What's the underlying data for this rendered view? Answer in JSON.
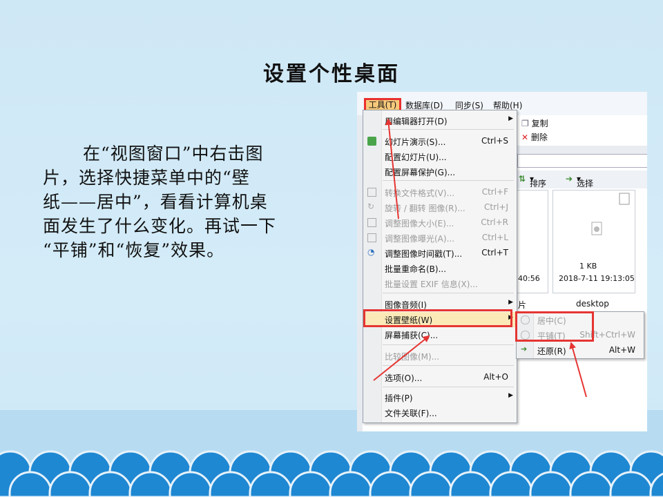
{
  "slide": {
    "title": "设置个性桌面",
    "paragraph_lines": [
      "在“视图窗口”中右击图",
      "片，选择快捷菜单中的“壁",
      "纸——居中”，看看计算机桌",
      "面发生了什么变化。再试一下",
      "“平铺”和“恢复”效果。"
    ]
  },
  "menubar": {
    "tools": "工具(T)",
    "items": [
      "数据库(D)",
      "同步(S)",
      "帮助(H)"
    ]
  },
  "toolbar": {
    "copy": "复制",
    "delete": "删除"
  },
  "viewbar": {
    "sort": "排序",
    "select": "选择"
  },
  "files": [
    {
      "name": "片",
      "date": "40:56"
    },
    {
      "name": "desktop",
      "size": "1 KB",
      "date": "2018-7-11 19:13:05"
    }
  ],
  "menu": [
    {
      "label": "用编辑器打开(D)",
      "shortcut": "",
      "submenu": true,
      "disabled": false
    },
    {
      "label": "幻灯片演示(S)...",
      "shortcut": "Ctrl+S",
      "disabled": false
    },
    {
      "label": "配置幻灯片(U)...",
      "shortcut": "",
      "disabled": false
    },
    {
      "label": "配置屏幕保护(G)...",
      "shortcut": "",
      "disabled": false
    },
    {
      "label": "转换文件格式(V)...",
      "shortcut": "Ctrl+F",
      "disabled": true
    },
    {
      "label": "旋转 / 翻转 图像(R)...",
      "shortcut": "Ctrl+J",
      "disabled": true
    },
    {
      "label": "调整图像大小(E)...",
      "shortcut": "Ctrl+R",
      "disabled": true
    },
    {
      "label": "调整图像曝光(A)...",
      "shortcut": "Ctrl+L",
      "disabled": true
    },
    {
      "label": "调整图像时间戳(T)...",
      "shortcut": "Ctrl+T",
      "disabled": false
    },
    {
      "label": "批量重命名(B)...",
      "shortcut": "",
      "disabled": false
    },
    {
      "label": "批量设置 EXIF 信息(X)...",
      "shortcut": "",
      "disabled": true
    },
    {
      "label": "图像音频(I)",
      "shortcut": "",
      "submenu": true,
      "disabled": false
    },
    {
      "label": "设置壁纸(W)",
      "shortcut": "",
      "submenu": true,
      "disabled": false
    },
    {
      "label": "屏幕捕获(C)...",
      "shortcut": "",
      "disabled": false
    },
    {
      "label": "比较图像(M)...",
      "shortcut": "",
      "disabled": true
    },
    {
      "label": "选项(O)...",
      "shortcut": "Alt+O",
      "disabled": false
    },
    {
      "label": "插件(P)",
      "shortcut": "",
      "submenu": true,
      "disabled": false
    },
    {
      "label": "文件关联(F)...",
      "shortcut": "",
      "disabled": false
    }
  ],
  "wallpaper_submenu": [
    {
      "label": "居中(C)",
      "shortcut": "",
      "disabled": true
    },
    {
      "label": "平铺(T)",
      "shortcut": "Shift+Ctrl+W",
      "disabled": true
    },
    {
      "label": "还原(R)",
      "shortcut": "Alt+W",
      "disabled": false
    }
  ],
  "colors": {
    "background": "#cfe8f6",
    "wave": "#1f88d3",
    "highlight_red": "#e53532",
    "tools_highlight": "#f7c97b"
  }
}
